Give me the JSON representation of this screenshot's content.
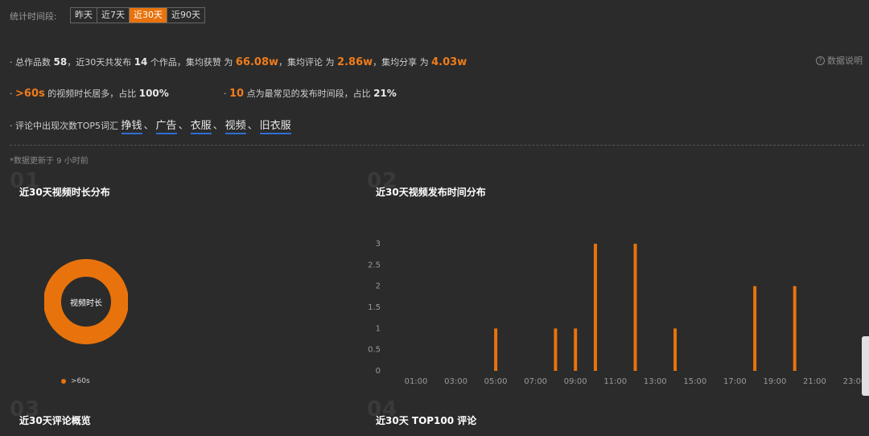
{
  "period": {
    "label": "统计时间段:",
    "options": [
      "昨天",
      "近7天",
      "近30天",
      "近90天"
    ],
    "active_index": 2
  },
  "summary": {
    "line1": {
      "prefix": "· 总作品数",
      "total_works": "58",
      "mid1": "，近30天共发布",
      "published": "14",
      "mid2": "个作品，",
      "likes_label": "集均获赞 为",
      "likes": "66.08w",
      "comments_label": "，集均评论 为",
      "comments": "2.86w",
      "shares_label": "，集均分享 为",
      "shares": "4.03w"
    },
    "help": "数据说明",
    "line2a": {
      "prefix": "·",
      "value": ">60s",
      "text": "的视频时长居多，占比",
      "pct": "100%"
    },
    "line2b": {
      "prefix": "·",
      "value": "10",
      "text": "点为最常见的发布时间段，占比",
      "pct": "21%"
    },
    "line3": {
      "prefix": "· 评论中出现次数TOP5词汇",
      "keywords": [
        "挣钱",
        "广告",
        "衣服",
        "视频",
        "旧衣服"
      ],
      "separator": "、"
    }
  },
  "update_note": "*数据更新于 9 小时前",
  "sections": [
    {
      "num": "01",
      "title": "近30天视频时长分布"
    },
    {
      "num": "02",
      "title": "近30天视频发布时间分布"
    },
    {
      "num": "03",
      "title": "近30天评论概览"
    },
    {
      "num": "04",
      "title": "近30天 TOP100 评论"
    }
  ],
  "colors": {
    "accent": "#e8730c",
    "keyword_underline": "#2f6fd4"
  },
  "chart_data": [
    {
      "type": "pie",
      "center_label": "视频时长",
      "slices": [
        {
          "name": ">60s",
          "value": 100
        }
      ],
      "legend": [
        ">60s"
      ],
      "legend_placement": "bottom-left"
    },
    {
      "type": "bar",
      "x": [
        "01:00",
        "02:00",
        "03:00",
        "04:00",
        "05:00",
        "06:00",
        "07:00",
        "08:00",
        "09:00",
        "10:00",
        "11:00",
        "12:00",
        "13:00",
        "14:00",
        "15:00",
        "16:00",
        "17:00",
        "18:00",
        "19:00",
        "20:00",
        "21:00",
        "22:00",
        "23:00"
      ],
      "tick_labels": [
        "01:00",
        "03:00",
        "05:00",
        "07:00",
        "09:00",
        "11:00",
        "13:00",
        "15:00",
        "17:00",
        "19:00",
        "21:00",
        "23:00"
      ],
      "values": [
        0,
        0,
        0,
        0,
        1,
        0,
        0,
        1,
        1,
        3,
        0,
        3,
        0,
        1,
        0,
        0,
        0,
        2,
        0,
        2,
        0,
        0,
        0
      ],
      "y_ticks": [
        "0",
        "0.5",
        "1",
        "1.5",
        "2",
        "2.5",
        "3"
      ],
      "ylim": [
        0,
        3
      ],
      "grid": false
    }
  ]
}
